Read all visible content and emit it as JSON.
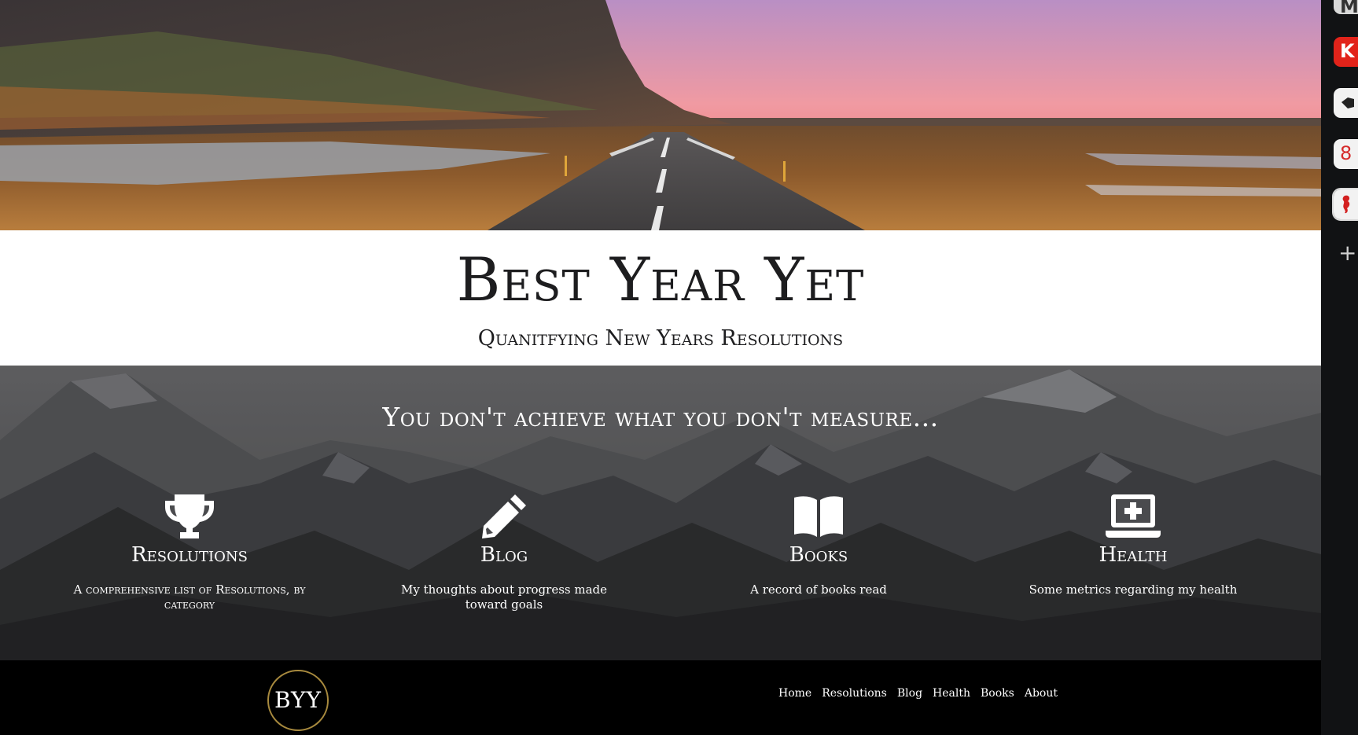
{
  "site": {
    "title": "Best Year Yet",
    "subtitle": "Quanitfying New Years Resolutions"
  },
  "features_section": {
    "tagline": "You don't achieve what you don't measure...",
    "items": [
      {
        "title": "Resolutions",
        "description": "A comprehensive list of Resolutions, by category",
        "icon": "trophy-icon"
      },
      {
        "title": "Blog",
        "description": "My thoughts about progress made toward goals",
        "icon": "pencil-icon"
      },
      {
        "title": "Books",
        "description": "A record of books read",
        "icon": "open-book-icon"
      },
      {
        "title": "Health",
        "description": "Some metrics regarding my health",
        "icon": "laptop-medical-icon"
      }
    ]
  },
  "footer": {
    "logo_text": "BYY",
    "nav": [
      "Home",
      "Resolutions",
      "Blog",
      "Health",
      "Books",
      "About"
    ]
  },
  "browser_tabs": {
    "items": [
      {
        "icon": "mail-tab-icon",
        "label": "M"
      },
      {
        "icon": "k-tab-icon",
        "label": "K"
      },
      {
        "icon": "pin-tab-icon",
        "label": ""
      },
      {
        "icon": "eight-tab-icon",
        "label": "8"
      },
      {
        "icon": "seahorse-tab-icon",
        "label": ""
      }
    ],
    "add_label": "+"
  },
  "colors": {
    "title_text": "#1d1d1f",
    "footer_bg": "#000000",
    "logo_ring": "#a88a3e",
    "hero_sky": "#f08a8a"
  }
}
